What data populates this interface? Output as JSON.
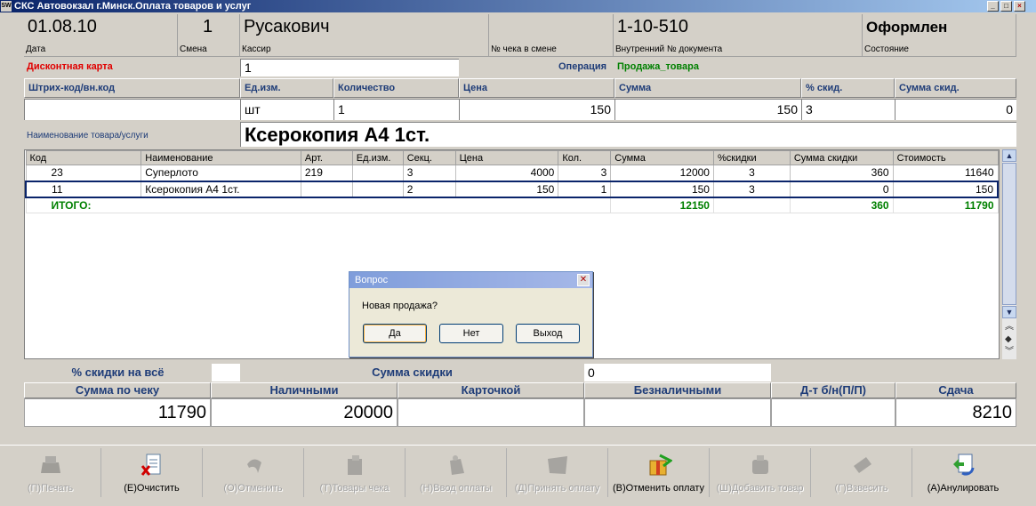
{
  "window": {
    "title": "СКС Автовокзал г.Минск.Оплата товаров и услуг",
    "logo": "SW"
  },
  "header": {
    "date": {
      "value": "01.08.10",
      "label": "Дата"
    },
    "shift": {
      "value": "1",
      "label": "Смена"
    },
    "cashier": {
      "value": "Русакович",
      "label": "Кассир"
    },
    "check_no": {
      "value": "",
      "label": "№ чека в смене"
    },
    "doc_no": {
      "value": "1-10-510",
      "label": "Внутренний № документа"
    },
    "state": {
      "value": "Оформлен",
      "label": "Состояние"
    }
  },
  "discount": {
    "label": "Дисконтная карта",
    "value": "1"
  },
  "operation": {
    "label": "Операция",
    "value": "Продажа_товара"
  },
  "entry": {
    "headers": [
      "Штрих-код/вн.код",
      "Ед.изм.",
      "Количество",
      "Цена",
      "Сумма",
      "% скид.",
      "Сумма скид."
    ],
    "barcode": "",
    "unit": "шт",
    "qty": "1",
    "price": "150",
    "sum": "150",
    "disc_pct": "3",
    "disc_sum": "0"
  },
  "name_field": {
    "label": "Наименование товара/услуги",
    "value": "Ксерокопия А4 1ст."
  },
  "grid": {
    "columns": [
      "Код",
      "Наименование",
      "Арт.",
      "Ед.изм.",
      "Секц.",
      "Цена",
      "Кол.",
      "Сумма",
      "%скидки",
      "Сумма скидки",
      "Стоимость"
    ],
    "rows": [
      {
        "code": "23",
        "name": "Суперлото",
        "art": "219",
        "unit": "",
        "sect": "3",
        "price": "4000",
        "qty": "3",
        "sum": "12000",
        "disc": "3",
        "disc_sum": "360",
        "cost": "11640"
      },
      {
        "code": "11",
        "name": "Ксерокопия А4 1ст.",
        "art": "",
        "unit": "",
        "sect": "2",
        "price": "150",
        "qty": "1",
        "sum": "150",
        "disc": "3",
        "disc_sum": "0",
        "cost": "150"
      }
    ],
    "total": {
      "label": "ИТОГО:",
      "sum": "12150",
      "disc_sum": "360",
      "cost": "11790"
    }
  },
  "dialog": {
    "title": "Вопрос",
    "message": "Новая продажа?",
    "yes": "Да",
    "no": "Нет",
    "exit": "Выход"
  },
  "summary": {
    "disc_all_label": "% скидки на всё",
    "disc_all_value": "",
    "disc_sum_label": "Сумма скидки",
    "disc_sum_value": "0",
    "headers": [
      "Сумма по чеку",
      "Наличными",
      "Карточкой",
      "Безналичными",
      "Д-т б/н(П/П)",
      "Сдача"
    ],
    "values": [
      "11790",
      "20000",
      "",
      "",
      "",
      "8210"
    ]
  },
  "toolbar": {
    "items": [
      {
        "label": "(П)Печать",
        "icon": "printer-icon",
        "enabled": false
      },
      {
        "label": "(Е)Очистить",
        "icon": "clear-document-icon",
        "enabled": true
      },
      {
        "label": "(О)Отменить",
        "icon": "undo-icon",
        "enabled": false
      },
      {
        "label": "(Т)Товары чека",
        "icon": "goods-icon",
        "enabled": false
      },
      {
        "label": "(Н)Ввод оплаты",
        "icon": "payment-icon",
        "enabled": false
      },
      {
        "label": "(Д)Принять оплату",
        "icon": "accept-payment-icon",
        "enabled": false
      },
      {
        "label": "(В)Отменить оплату",
        "icon": "cancel-payment-icon",
        "enabled": true
      },
      {
        "label": "(Ш)Добавить товар",
        "icon": "add-goods-icon",
        "enabled": false
      },
      {
        "label": "(Г)Взвесить",
        "icon": "weigh-icon",
        "enabled": false
      },
      {
        "label": "(А)Анулировать",
        "icon": "annul-icon",
        "enabled": true
      }
    ]
  },
  "colors": {
    "title_bar": "#0a246a",
    "label_blue": "#1e3c78",
    "discount_red": "#e00000",
    "operation_green": "#008000",
    "total_green": "#008000"
  }
}
